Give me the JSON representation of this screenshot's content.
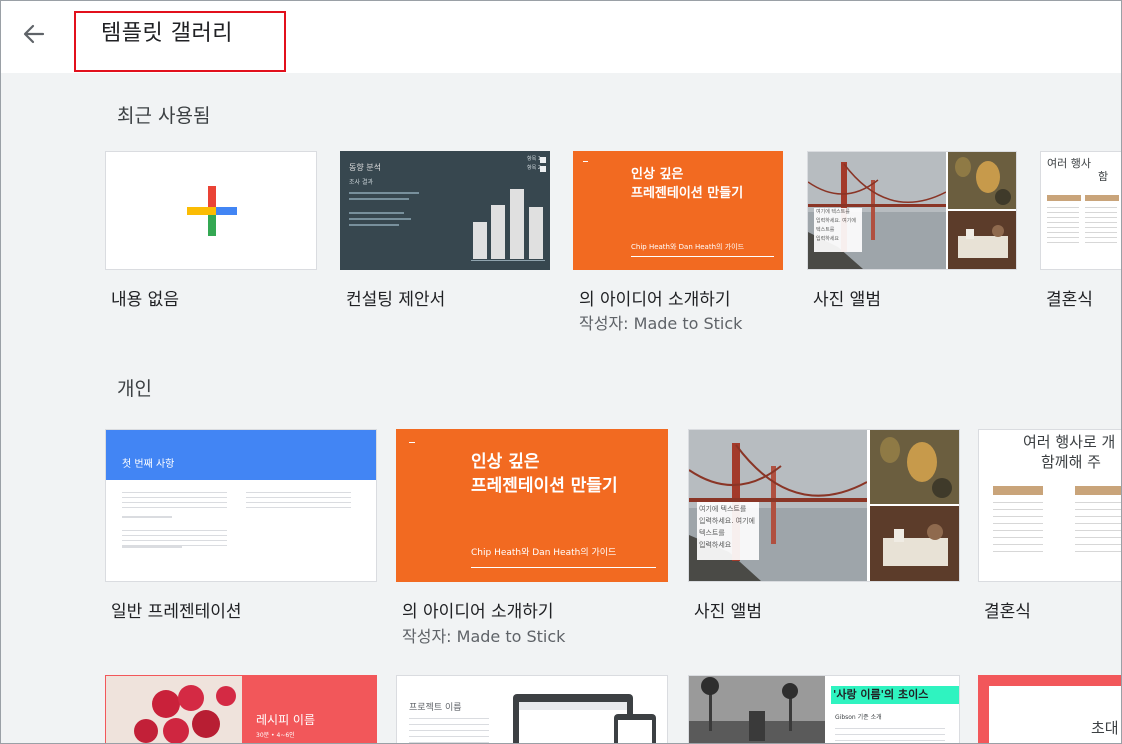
{
  "header": {
    "back_icon": "arrow-left-icon",
    "title": "템플릿 갤러리"
  },
  "recent": {
    "title": "최근 사용됨",
    "items": [
      {
        "label": "내용 없음"
      },
      {
        "label": "컨설팅 제안서",
        "thumb": {
          "title": "동향 분석",
          "subtitle": "조사 결과",
          "legend": [
            "항목 1",
            "항목 2"
          ]
        }
      },
      {
        "label": "의 아이디어 소개하기",
        "author": "작성자: Made to Stick",
        "thumb": {
          "title_line1": "인상 깊은",
          "title_line2": "프레젠테이션 만들기",
          "subtitle": "Chip Heath와 Dan Heath의 가이드"
        }
      },
      {
        "label": "사진 앨범",
        "thumb": {
          "caption": [
            "여기에 텍스트를",
            "입력하세요. 여기에",
            "텍스트를",
            "입력하세요"
          ]
        }
      },
      {
        "label": "결혼식",
        "thumb": {
          "title_line1": "여러 행사",
          "title_line2": "함"
        }
      }
    ]
  },
  "personal": {
    "title": "개인",
    "items": [
      {
        "label": "일반 프레젠테이션",
        "thumb": {
          "title": "첫 번째 사항"
        }
      },
      {
        "label": "의 아이디어 소개하기",
        "author": "작성자: Made to Stick",
        "thumb": {
          "title_line1": "인상 깊은",
          "title_line2": "프레젠테이션 만들기",
          "subtitle": "Chip Heath와 Dan Heath의 가이드"
        }
      },
      {
        "label": "사진 앨범",
        "thumb": {
          "caption": [
            "여기에 텍스트를",
            "입력하세요. 여기에",
            "텍스트를",
            "입력하세요"
          ]
        }
      },
      {
        "label": "결혼식",
        "thumb": {
          "title_line1": "여러 행사로 개",
          "title_line2": "함께해 주"
        }
      }
    ]
  },
  "third_row": {
    "items": [
      {
        "thumb": {
          "title": "레시피 이름",
          "subtitle": "30분 • 4~6인"
        }
      },
      {
        "thumb": {
          "title": "프로젝트 이름"
        }
      },
      {
        "thumb": {
          "title": "'사랑 이름'의 초이스",
          "subtitle": "Gibson 기준 소개"
        }
      },
      {
        "thumb": {
          "title": "초대"
        }
      }
    ]
  },
  "colors": {
    "accent_red": "#e2101c",
    "orange": "#f26a21",
    "blue_header": "#4285f4",
    "dark_slate": "#37474f",
    "coral": "#f2575a",
    "background": "#f1f3f4"
  }
}
